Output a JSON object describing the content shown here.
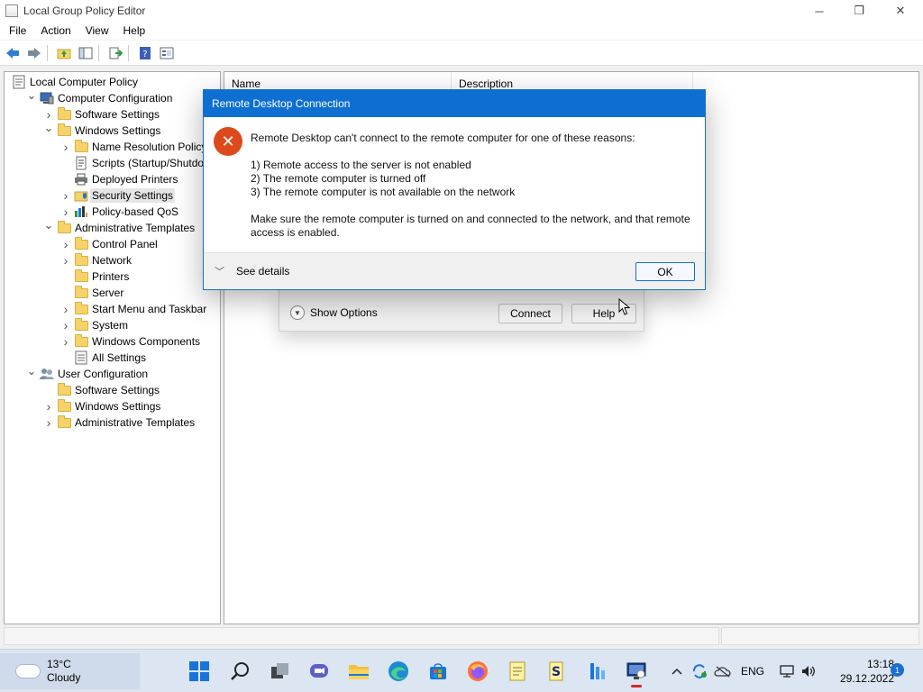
{
  "window": {
    "title": "Local Group Policy Editor",
    "controls": {
      "minimize": "─",
      "maximize": "❐",
      "close": "✕"
    }
  },
  "menubar": [
    "File",
    "Action",
    "View",
    "Help"
  ],
  "toolbar": {
    "icons": [
      "back-arrow-icon",
      "forward-arrow-icon",
      "up-folder-icon",
      "show-hide-tree-icon",
      "export-list-icon",
      "help-icon",
      "properties-icon"
    ]
  },
  "tree": [
    {
      "label": "Local Computer Policy",
      "icon": "policy-icon",
      "indent": 0,
      "expander": ""
    },
    {
      "label": "Computer Configuration",
      "icon": "computer-icon",
      "indent": 1,
      "expander": "open"
    },
    {
      "label": "Software Settings",
      "icon": "folder-icon",
      "indent": 2,
      "expander": "closed"
    },
    {
      "label": "Windows Settings",
      "icon": "folder-icon",
      "indent": 2,
      "expander": "open"
    },
    {
      "label": "Name Resolution Policy",
      "icon": "folder-icon",
      "indent": 3,
      "expander": "closed"
    },
    {
      "label": "Scripts (Startup/Shutdown)",
      "icon": "scripts-icon",
      "indent": 3,
      "expander": ""
    },
    {
      "label": "Deployed Printers",
      "icon": "printer-icon",
      "indent": 3,
      "expander": ""
    },
    {
      "label": "Security Settings",
      "icon": "security-icon",
      "indent": 3,
      "expander": "closed",
      "selected": true
    },
    {
      "label": "Policy-based QoS",
      "icon": "chart-icon",
      "indent": 3,
      "expander": "closed"
    },
    {
      "label": "Administrative Templates",
      "icon": "folder-icon",
      "indent": 2,
      "expander": "open"
    },
    {
      "label": "Control Panel",
      "icon": "folder-icon",
      "indent": 3,
      "expander": "closed"
    },
    {
      "label": "Network",
      "icon": "folder-icon",
      "indent": 3,
      "expander": "closed"
    },
    {
      "label": "Printers",
      "icon": "folder-icon",
      "indent": 3,
      "expander": ""
    },
    {
      "label": "Server",
      "icon": "folder-icon",
      "indent": 3,
      "expander": ""
    },
    {
      "label": "Start Menu and Taskbar",
      "icon": "folder-icon",
      "indent": 3,
      "expander": "closed"
    },
    {
      "label": "System",
      "icon": "folder-icon",
      "indent": 3,
      "expander": "closed"
    },
    {
      "label": "Windows Components",
      "icon": "folder-icon",
      "indent": 3,
      "expander": "closed"
    },
    {
      "label": "All Settings",
      "icon": "settings-list-icon",
      "indent": 3,
      "expander": ""
    },
    {
      "label": "User Configuration",
      "icon": "user-icon",
      "indent": 1,
      "expander": "open"
    },
    {
      "label": "Software Settings",
      "icon": "folder-icon",
      "indent": 2,
      "expander": ""
    },
    {
      "label": "Windows Settings",
      "icon": "folder-icon",
      "indent": 2,
      "expander": "closed"
    },
    {
      "label": "Administrative Templates",
      "icon": "folder-icon",
      "indent": 2,
      "expander": "closed"
    }
  ],
  "list": {
    "columns": {
      "name": "Name",
      "description": "Description"
    }
  },
  "rdc_window": {
    "show_options": "Show Options",
    "connect": "Connect",
    "help": "Help"
  },
  "dialog": {
    "title": "Remote Desktop Connection",
    "heading": "Remote Desktop can't connect to the remote computer for one of these reasons:",
    "reasons": [
      "1) Remote access to the server is not enabled",
      "2) The remote computer is turned off",
      "3) The remote computer is not available on the network"
    ],
    "advice_line1": "Make sure the remote computer is turned on and connected to the network, and that remote",
    "advice_line2": "access is enabled.",
    "see_details": "See details",
    "ok": "OK"
  },
  "taskbar": {
    "weather": {
      "temp": "13°C",
      "condition": "Cloudy"
    },
    "apps": [
      "start-icon",
      "search-icon",
      "task-view-icon",
      "chat-icon",
      "file-explorer-icon",
      "edge-icon",
      "store-icon",
      "firefox-icon",
      "notepad-icon",
      "script-icon",
      "network-icon",
      "remote-desktop-icon"
    ],
    "tray": {
      "language": "ENG"
    },
    "clock": {
      "time": "13:18",
      "date": "29.12.2022"
    },
    "notifications": "1"
  }
}
